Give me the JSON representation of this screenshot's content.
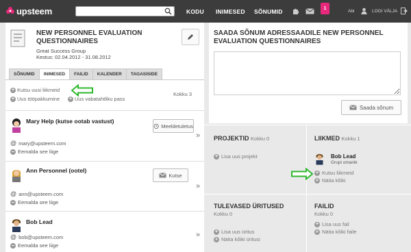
{
  "header": {
    "logo_text": "upsteem",
    "search_placeholder": "",
    "nav": [
      "KODU",
      "INIMESED",
      "SÕNUMID"
    ],
    "notification_count": "1",
    "help": "Abi",
    "logout": "LOGI VÄLJA"
  },
  "project": {
    "title": "NEW PERSONNEL EVALUATION QUESTIONNAIRES",
    "org": "Great Success Group",
    "dates": "Kestus: 02.04.2012 - 31.08.2012"
  },
  "tabs": [
    "SÕNUMID",
    "INIMESED",
    "FAILID",
    "KALENDER",
    "TAGASISIDE"
  ],
  "people_actions": {
    "invite": "Kutsu uusi liikmeid",
    "new_job": "Uus tööpakkumine",
    "new_volunteer": "Uus vabatahtliku pass",
    "total": "Kokku 3"
  },
  "members": [
    {
      "name": "Mary Help (kutse ootab vastust)",
      "email": "mary@upsteem.com",
      "remove": "Eemalda see liige",
      "button": "Meeldetuletus"
    },
    {
      "name": "Ann Personnel (ootel)",
      "email": "ann@upsteem.com",
      "remove": "Eemalda see liige",
      "button": "Kutse"
    },
    {
      "name": "Bob Lead",
      "email": "bob@upsteem.com",
      "remove": "Eemalda see liige",
      "button": ""
    }
  ],
  "message": {
    "title": "SAADA SÕNUM ADRESSAADILE NEW PERSONNEL EVALUATION QUESTIONNAIRES",
    "text": "",
    "send": "Saada sõnum"
  },
  "projects_panel": {
    "title": "PROJEKTID",
    "count": "Kokku 0",
    "add": "Lisa uus projekt"
  },
  "members_panel": {
    "title": "LIIKMED",
    "count": "Kokku 1",
    "member_name": "Bob Lead",
    "member_role": "Grupi omanik",
    "invite": "Kutsu liikmeid",
    "show_all": "Näita kõiki"
  },
  "events_panel": {
    "title": "TULEVASED ÜRITUSED",
    "count": "Kokku 0",
    "add": "Lisa uus üritus",
    "show_all": "Näita kõiki üritusi"
  },
  "files_panel": {
    "title": "FAILID",
    "count": "Kokku 0",
    "add": "Lisa uus fail",
    "show_all": "Näita kõiki faile"
  },
  "colors": {
    "topbar": "#3c3c3c",
    "accent": "#e8287c",
    "arrow": "#2eb82e"
  }
}
